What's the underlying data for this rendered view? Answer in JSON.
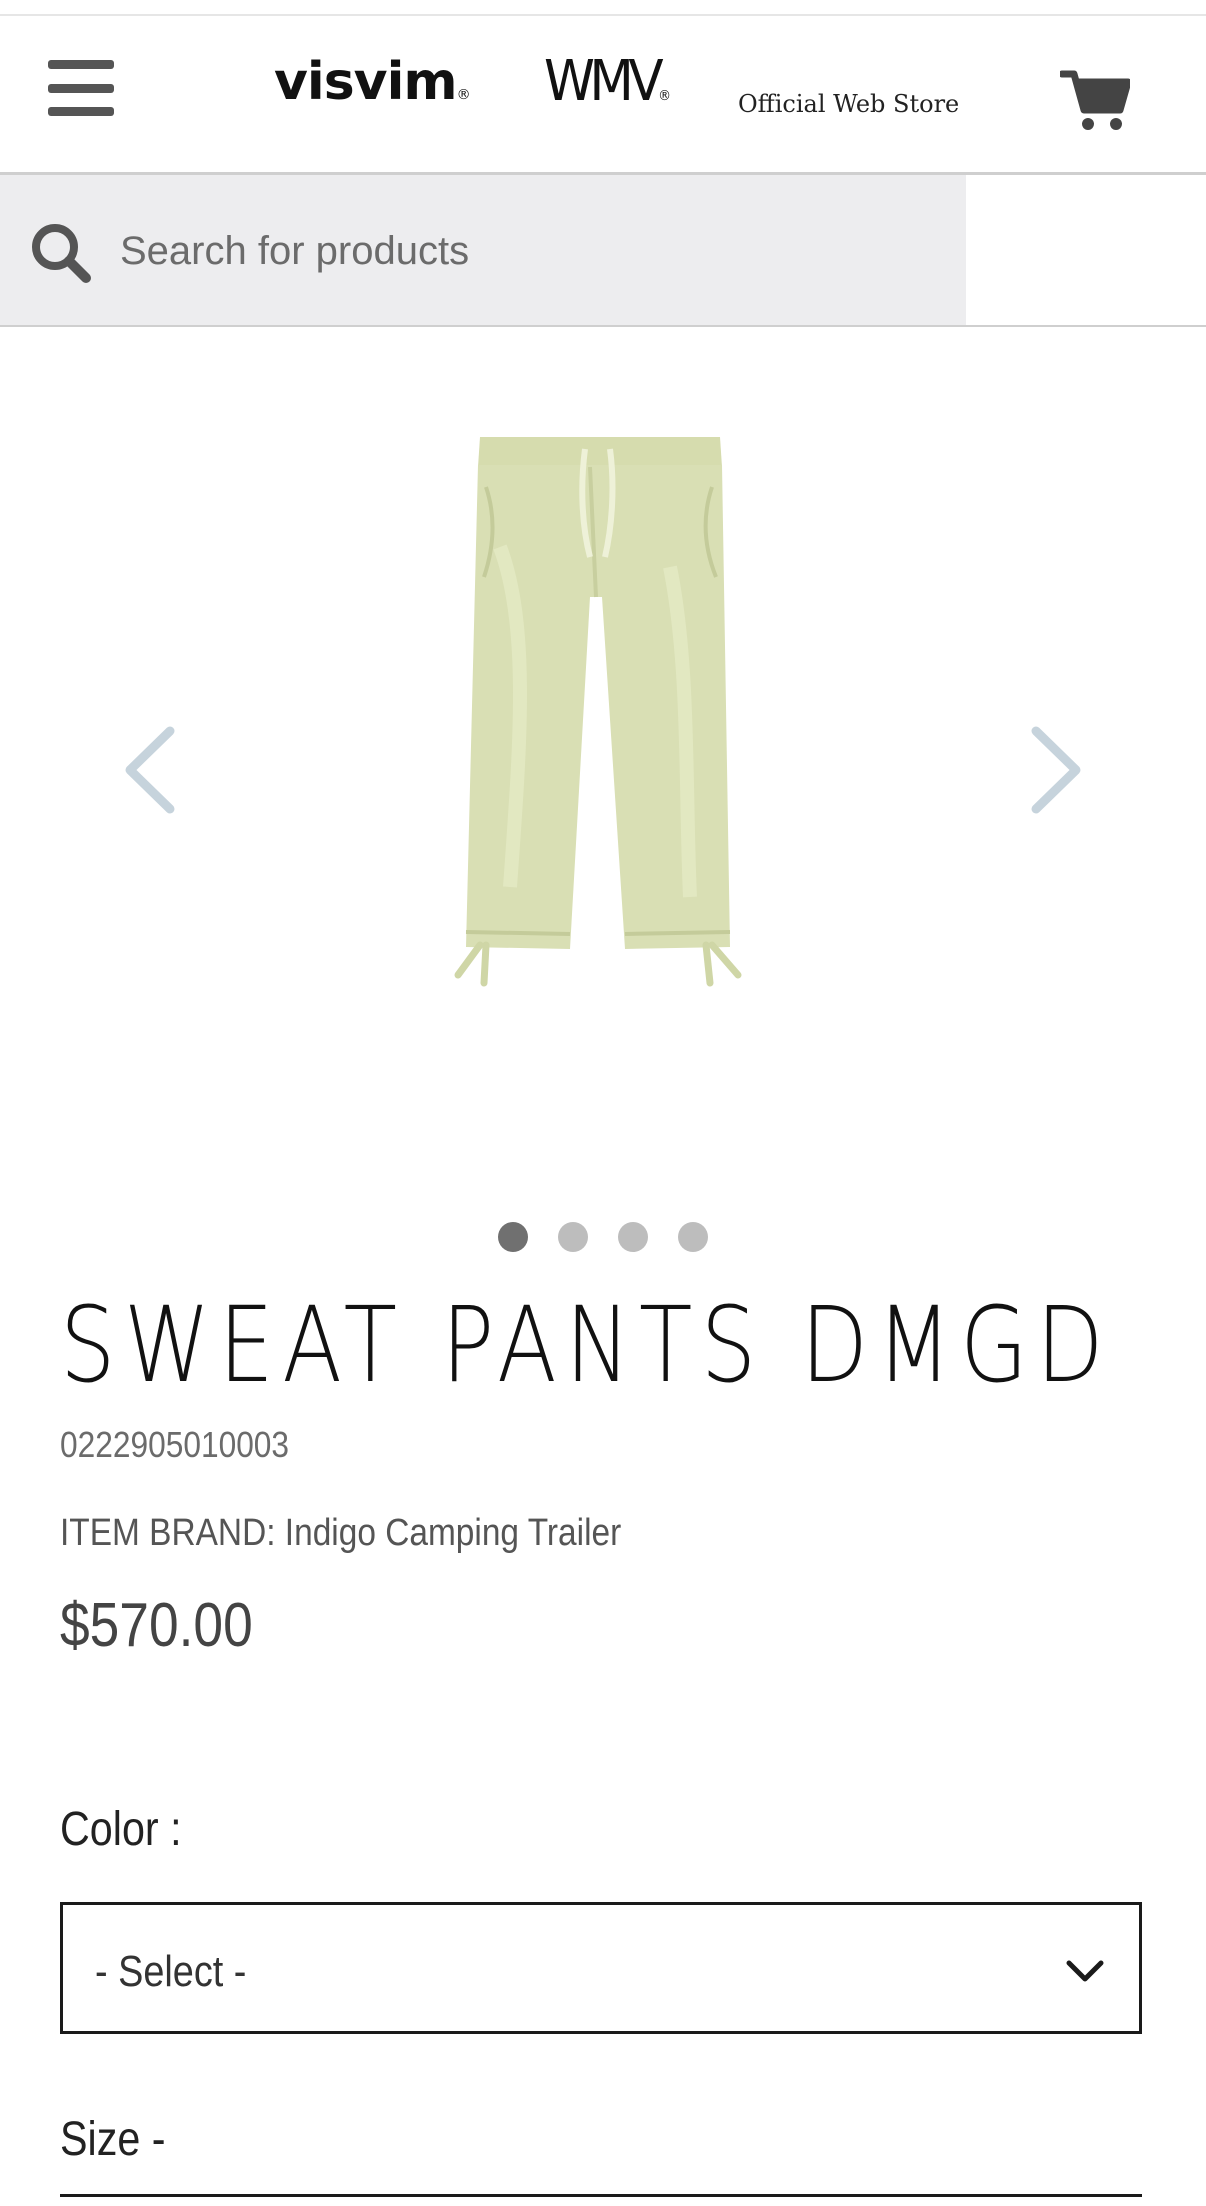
{
  "header": {
    "logo_primary": "visvim",
    "logo_secondary": "WMV",
    "store_label": "Official Web Store",
    "menu_icon": "hamburger-menu-icon",
    "cart_icon": "shopping-cart-icon"
  },
  "search": {
    "placeholder": "Search for products",
    "icon": "search-icon"
  },
  "carousel": {
    "prev_icon": "chevron-left-icon",
    "next_icon": "chevron-right-icon",
    "image_alt": "SWEAT PANTS DMGD",
    "dot_count": 4,
    "active_index": 0
  },
  "product": {
    "title": "SWEAT PANTS DMGD",
    "sku": "0222905010003",
    "brand_line": "ITEM BRAND: Indigo Camping Trailer",
    "price": "$570.00"
  },
  "options": {
    "color_label": "Color :",
    "color_selected": "- Select -",
    "size_label": "Size -"
  },
  "colors": {
    "arrow": "#c6d3dc",
    "pants": "#d9dfb4",
    "dot_active": "#707070",
    "dot_inactive": "#bdbdbd"
  }
}
